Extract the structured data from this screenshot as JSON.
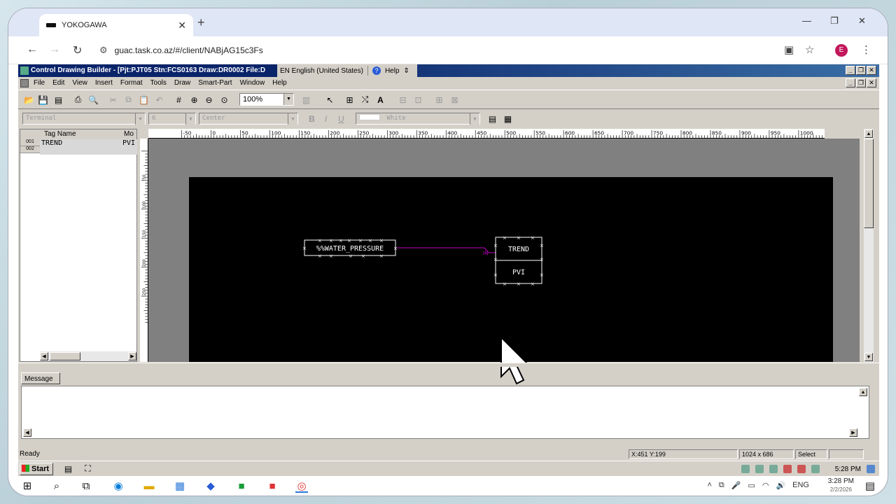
{
  "browser": {
    "tab_title": "YOKOGAWA",
    "url": "guac.task.co.az/#/client/NABjAG15c3Fs",
    "profile_initial": "E"
  },
  "app": {
    "title": "Control Drawing Builder - [Pjt:PJT05 Stn:FCS0163 Draw:DR0002 File:D",
    "language": "EN English (United States)",
    "help": "Help",
    "menu": [
      "File",
      "Edit",
      "View",
      "Insert",
      "Format",
      "Tools",
      "Draw",
      "Smart-Part",
      "Window",
      "Help"
    ],
    "zoom": "100%",
    "font_combo": "Terminal",
    "size_combo": "6",
    "align_combo": "Center",
    "color_combo": "White"
  },
  "taglist": {
    "headers": [
      "Tag Name",
      "Mo"
    ],
    "rows": [
      {
        "num": "001",
        "tag": "TREND",
        "model": "PVI"
      },
      {
        "num": "002",
        "tag": "",
        "model": ""
      }
    ]
  },
  "ruler": {
    "h_labels": [
      "-50",
      "0",
      "50",
      "100",
      "150",
      "200",
      "250",
      "300",
      "350",
      "400",
      "450",
      "500",
      "550",
      "600",
      "650",
      "700",
      "750",
      "800",
      "850",
      "900",
      "950",
      "1000"
    ],
    "v_labels": [
      "50",
      "100",
      "150",
      "200",
      "250"
    ]
  },
  "drawing": {
    "input_block": "%%WATER_PRESSURE",
    "func_block_tag": "TREND",
    "func_block_model": "PVI",
    "terminal_label": "IN"
  },
  "message_tab": "Message",
  "status": {
    "ready": "Ready",
    "coords": "X:451 Y:199",
    "resolution": "1024 x 686",
    "mode": "Select"
  },
  "xp_taskbar": {
    "start": "Start",
    "time": "5:28 PM"
  },
  "w10_taskbar": {
    "language": "ENG",
    "time": "3:28 PM",
    "date": "2/2/2026"
  },
  "colors": {
    "title_bar": "#0a246a",
    "wire": "#c000c0",
    "block_border": "#ffffff",
    "canvas_bg": "#000000"
  }
}
